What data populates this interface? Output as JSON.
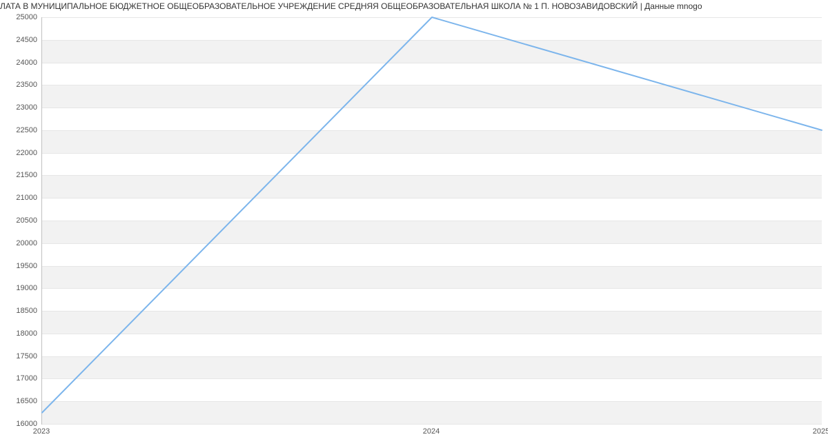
{
  "chart_data": {
    "type": "line",
    "title": "ЛАТА В МУНИЦИПАЛЬНОЕ БЮДЖЕТНОЕ ОБЩЕОБРАЗОВАТЕЛЬНОЕ УЧРЕЖДЕНИЕ СРЕДНЯЯ ОБЩЕОБРАЗОВАТЕЛЬНАЯ ШКОЛА № 1 П. НОВОЗАВИДОВСКИЙ | Данные mnogo",
    "x": [
      2023,
      2024,
      2025
    ],
    "values": [
      16250,
      25000,
      22500
    ],
    "xlabel": "",
    "ylabel": "",
    "xlim": [
      2023,
      2025
    ],
    "ylim": [
      16000,
      25000
    ],
    "y_ticks": [
      16000,
      16500,
      17000,
      17500,
      18000,
      18500,
      19000,
      19500,
      20000,
      20500,
      21000,
      21500,
      22000,
      22500,
      23000,
      23500,
      24000,
      24500,
      25000
    ],
    "x_ticks": [
      2023,
      2024,
      2025
    ],
    "line_color": "#7cb5ec"
  }
}
